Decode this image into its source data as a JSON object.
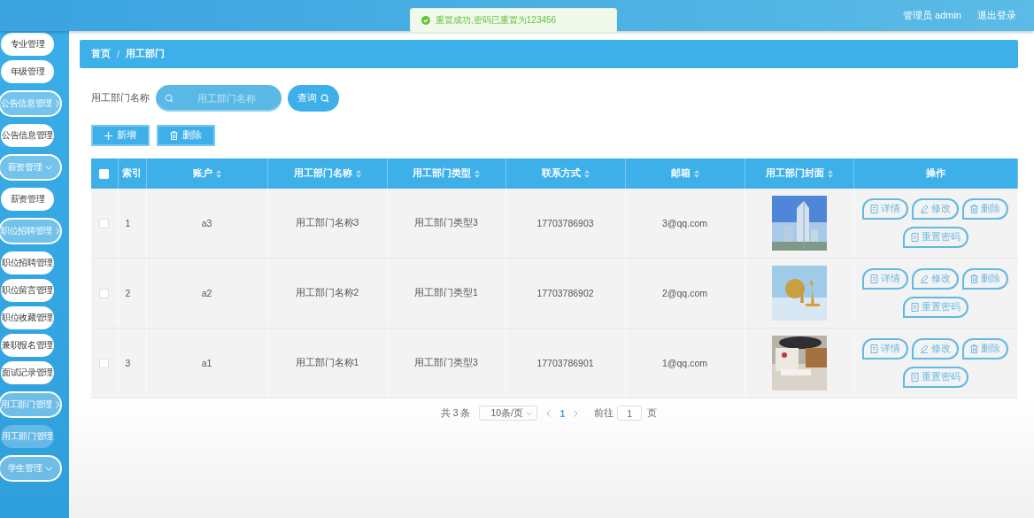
{
  "header": {
    "user": "管理员 admin",
    "logout": "退出登录"
  },
  "toast": {
    "message": "重置成功,密码已重置为123456"
  },
  "sidebar": {
    "items": [
      {
        "kind": "child",
        "label": "专业管理",
        "selected": false
      },
      {
        "kind": "child",
        "label": "年级管理",
        "selected": false
      },
      {
        "kind": "parent",
        "label": "公告信息管理",
        "expanded": false
      },
      {
        "kind": "child",
        "label": "公告信息管理",
        "selected": false
      },
      {
        "kind": "parent",
        "label": "薪资管理",
        "expanded": true
      },
      {
        "kind": "child",
        "label": "薪资管理",
        "selected": false
      },
      {
        "kind": "parent",
        "label": "职位招聘管理",
        "expanded": false
      },
      {
        "kind": "child",
        "label": "职位招聘管理",
        "selected": false
      },
      {
        "kind": "child",
        "label": "职位留言管理",
        "selected": false
      },
      {
        "kind": "child",
        "label": "职位收藏管理",
        "selected": false
      },
      {
        "kind": "child",
        "label": "兼职报名管理",
        "selected": false
      },
      {
        "kind": "child",
        "label": "面试记录管理",
        "selected": false
      },
      {
        "kind": "parent",
        "label": "用工部门管理",
        "expanded": false
      },
      {
        "kind": "child",
        "label": "用工部门管理",
        "selected": true
      },
      {
        "kind": "parent",
        "label": "学生管理",
        "expanded": true
      }
    ]
  },
  "breadcrumb": {
    "items": [
      "首页",
      "用工部门"
    ],
    "separator": "/"
  },
  "search": {
    "label": "用工部门名称",
    "placeholder": "用工部门名称",
    "button": "查询"
  },
  "actions": [
    {
      "kind": "add",
      "label": "新增"
    },
    {
      "kind": "delete",
      "label": "删除"
    }
  ],
  "table": {
    "select_all": {
      "checked": false
    },
    "columns": [
      {
        "label": "索引",
        "sortable": false
      },
      {
        "label": "账户",
        "sortable": true
      },
      {
        "label": "用工部门名称",
        "sortable": true
      },
      {
        "label": "用工部门类型",
        "sortable": true
      },
      {
        "label": "联系方式",
        "sortable": true
      },
      {
        "label": "邮箱",
        "sortable": true
      },
      {
        "label": "用工部门封面",
        "sortable": true
      },
      {
        "label": "操作",
        "sortable": false
      }
    ],
    "rows": [
      {
        "checked": false,
        "cells": [
          "1",
          "a3",
          "用工部门名称3",
          "用工部门类型3",
          "17703786903",
          "3@qq.com"
        ],
        "actions": [
          {
            "kind": "detail",
            "label": "详情"
          },
          {
            "kind": "edit",
            "label": "修改"
          },
          {
            "kind": "delete",
            "label": "删除"
          },
          {
            "kind": "reset",
            "label": "重置密码"
          }
        ]
      },
      {
        "checked": false,
        "cells": [
          "2",
          "a2",
          "用工部门名称2",
          "用工部门类型1",
          "17703786902",
          "2@qq.com"
        ],
        "actions": [
          {
            "kind": "detail",
            "label": "详情"
          },
          {
            "kind": "edit",
            "label": "修改"
          },
          {
            "kind": "delete",
            "label": "删除"
          },
          {
            "kind": "reset",
            "label": "重置密码"
          }
        ]
      },
      {
        "checked": false,
        "cells": [
          "3",
          "a1",
          "用工部门名称1",
          "用工部门类型3",
          "17703786901",
          "1@qq.com"
        ],
        "actions": [
          {
            "kind": "detail",
            "label": "详情"
          },
          {
            "kind": "edit",
            "label": "修改"
          },
          {
            "kind": "delete",
            "label": "删除"
          },
          {
            "kind": "reset",
            "label": "重置密码"
          }
        ]
      }
    ]
  },
  "pagination": {
    "total": "共 3 条",
    "page_size": "10条/页",
    "pages": [
      {
        "label": "1",
        "selected": true
      }
    ],
    "goto_label": "前往",
    "goto_value": "1",
    "goto_suffix": "页"
  }
}
